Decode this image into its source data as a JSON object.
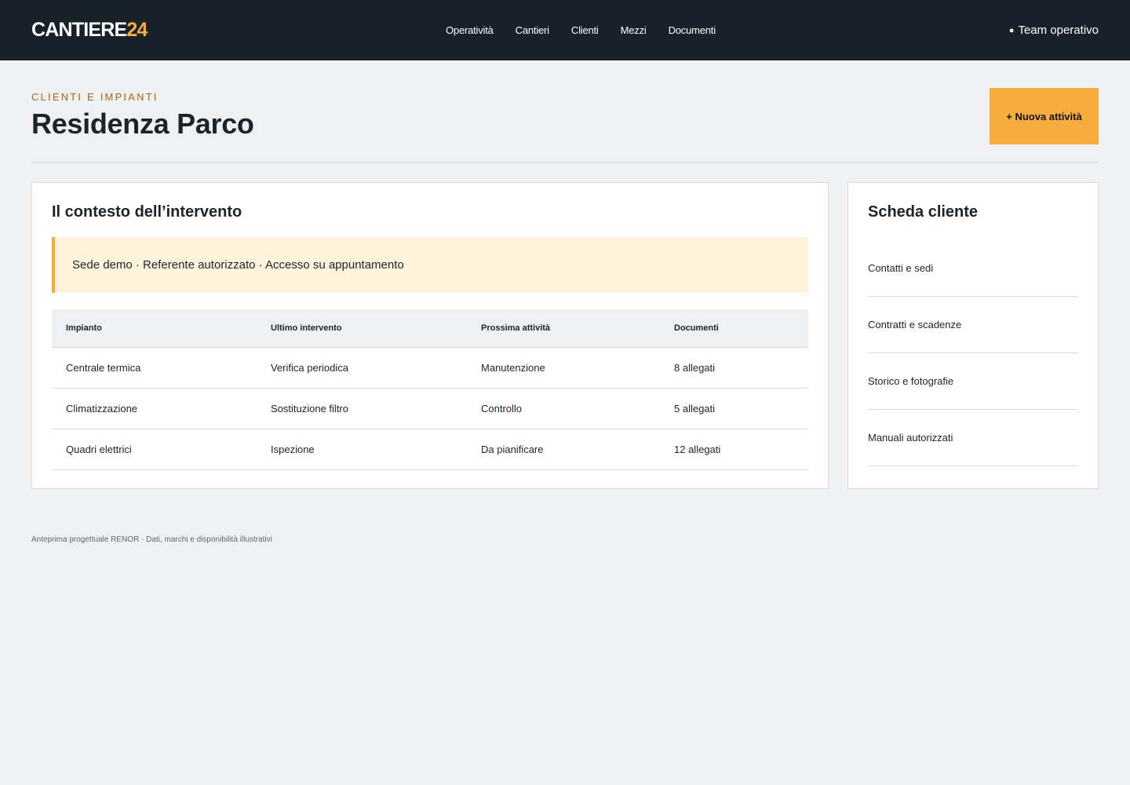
{
  "header": {
    "logo_main": "CANTIERE",
    "logo_accent": "24",
    "nav": [
      "Operatività",
      "Cantieri",
      "Clienti",
      "Mezzi",
      "Documenti"
    ],
    "team_dot": "●",
    "team_label": "Team operativo"
  },
  "page": {
    "eyebrow": "CLIENTI E IMPIANTI",
    "title": "Residenza Parco",
    "new_button": "+ Nuova attività"
  },
  "context": {
    "title": "Il contesto dell’intervento",
    "notice": "Sede demo · Referente autorizzato · Accesso su appuntamento",
    "table": {
      "headers": [
        "Impianto",
        "Ultimo intervento",
        "Prossima attività",
        "Documenti"
      ],
      "rows": [
        [
          "Centrale termica",
          "Verifica periodica",
          "Manutenzione",
          "8 allegati"
        ],
        [
          "Climatizzazione",
          "Sostituzione filtro",
          "Controllo",
          "5 allegati"
        ],
        [
          "Quadri elettrici",
          "Ispezione",
          "Da pianificare",
          "12 allegati"
        ]
      ]
    }
  },
  "client_card": {
    "title": "Scheda cliente",
    "items": [
      "Contatti e sedi",
      "Contratti e scadenze",
      "Storico e fotografie",
      "Manuali autorizzati"
    ]
  },
  "footer": "Anteprima progettuale RENOR · Dati, marchi e disponibilità illustrativi",
  "colors": {
    "topbar": "#18212a",
    "accent": "#f6ad3c",
    "eyebrow": "#a8660c",
    "notice_bg": "#fff3dc",
    "page_bg": "#eff0f2"
  }
}
